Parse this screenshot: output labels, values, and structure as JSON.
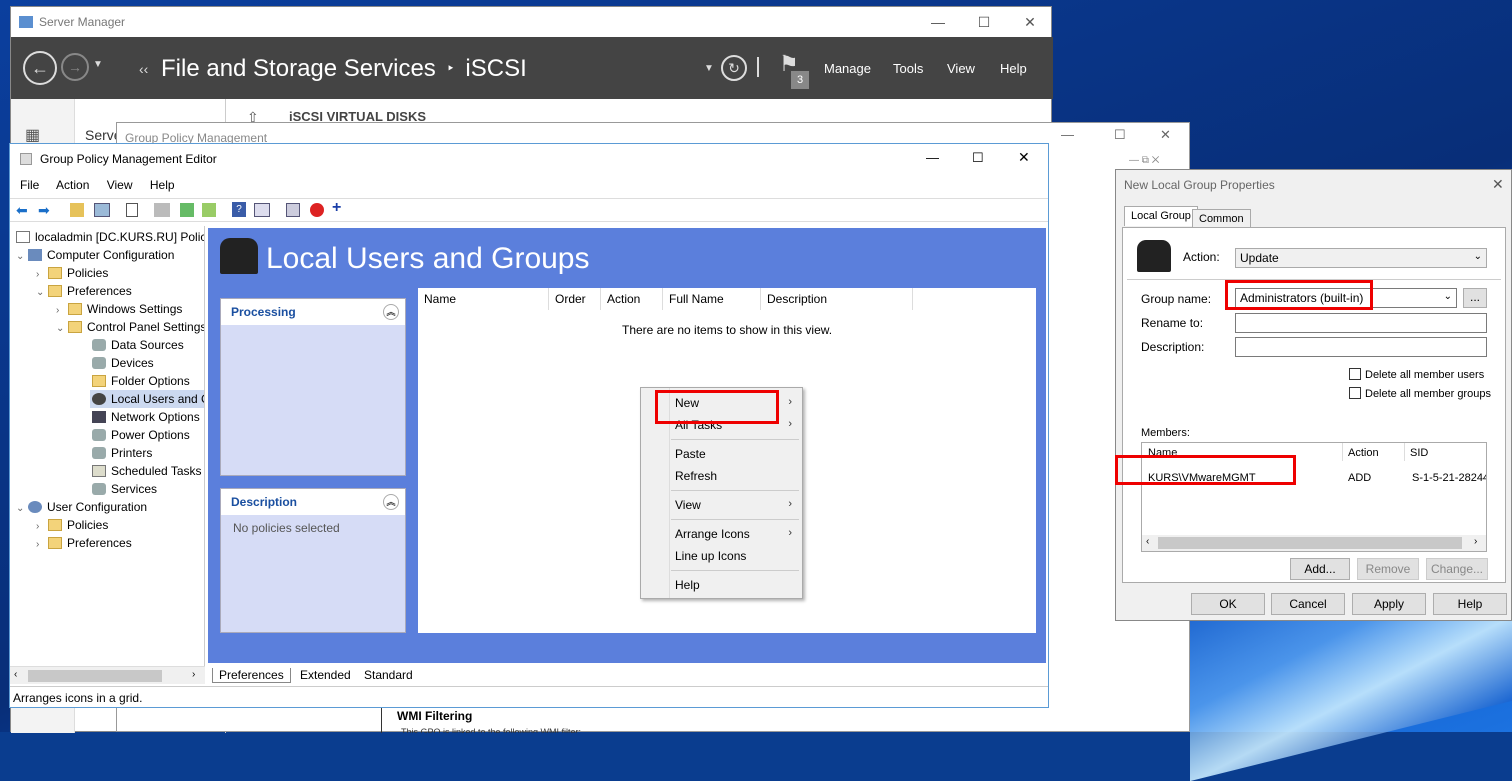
{
  "server_manager": {
    "title": "Server Manager",
    "breadcrumb_1": "File and Storage Services",
    "breadcrumb_sep": "‣",
    "breadcrumb_2": "iSCSI",
    "menu": [
      "Manage",
      "Tools",
      "View",
      "Help"
    ],
    "notif_count": "3",
    "section_heading": "iSCSI VIRTUAL DISKS",
    "side_label": "Serve"
  },
  "gpm": {
    "title": "Group Policy Management",
    "wmi_heading": "WMI Filtering",
    "wmi_text": "This GPO is linked to the following WMI filter:"
  },
  "editor": {
    "title": "Group Policy Management Editor",
    "menu": [
      "File",
      "Action",
      "View",
      "Help"
    ],
    "status": "Arranges icons in a grid.",
    "tree": {
      "root": "localadmin [DC.KURS.RU] Policy",
      "computer_config": "Computer Configuration",
      "policies": "Policies",
      "preferences": "Preferences",
      "windows_settings": "Windows Settings",
      "control_panel": "Control Panel Settings",
      "items": [
        "Data Sources",
        "Devices",
        "Folder Options",
        "Local Users and G",
        "Network Options",
        "Power Options",
        "Printers",
        "Scheduled Tasks",
        "Services"
      ],
      "user_config": "User Configuration",
      "user_policies": "Policies",
      "user_preferences": "Preferences"
    },
    "header": "Local Users and Groups",
    "processing": "Processing",
    "description_title": "Description",
    "description_text": "No policies selected",
    "columns": [
      "Name",
      "Order",
      "Action",
      "Full Name",
      "Description"
    ],
    "empty_text": "There are no items to show in this view.",
    "tabs": [
      "Preferences",
      "Extended",
      "Standard"
    ],
    "context_menu": {
      "new": "New",
      "all_tasks": "All Tasks",
      "paste": "Paste",
      "refresh": "Refresh",
      "view": "View",
      "arrange": "Arrange Icons",
      "lineup": "Line up Icons",
      "help": "Help"
    }
  },
  "dialog": {
    "title": "New Local Group Properties",
    "tab_local": "Local Group",
    "tab_common": "Common",
    "action_label": "Action:",
    "action_value": "Update",
    "group_name_label": "Group name:",
    "group_name_value": "Administrators (built-in)",
    "rename_label": "Rename to:",
    "description_label": "Description:",
    "delete_users": "Delete all member users",
    "delete_groups": "Delete all member groups",
    "members_label": "Members:",
    "member_cols": [
      "Name",
      "Action",
      "SID"
    ],
    "member_row": {
      "name": "KURS\\VMwareMGMT",
      "action": "ADD",
      "sid": "S-1-5-21-28244"
    },
    "buttons": {
      "add": "Add...",
      "remove": "Remove",
      "change": "Change...",
      "ok": "OK",
      "cancel": "Cancel",
      "apply": "Apply",
      "help": "Help"
    },
    "ellipsis": "..."
  }
}
